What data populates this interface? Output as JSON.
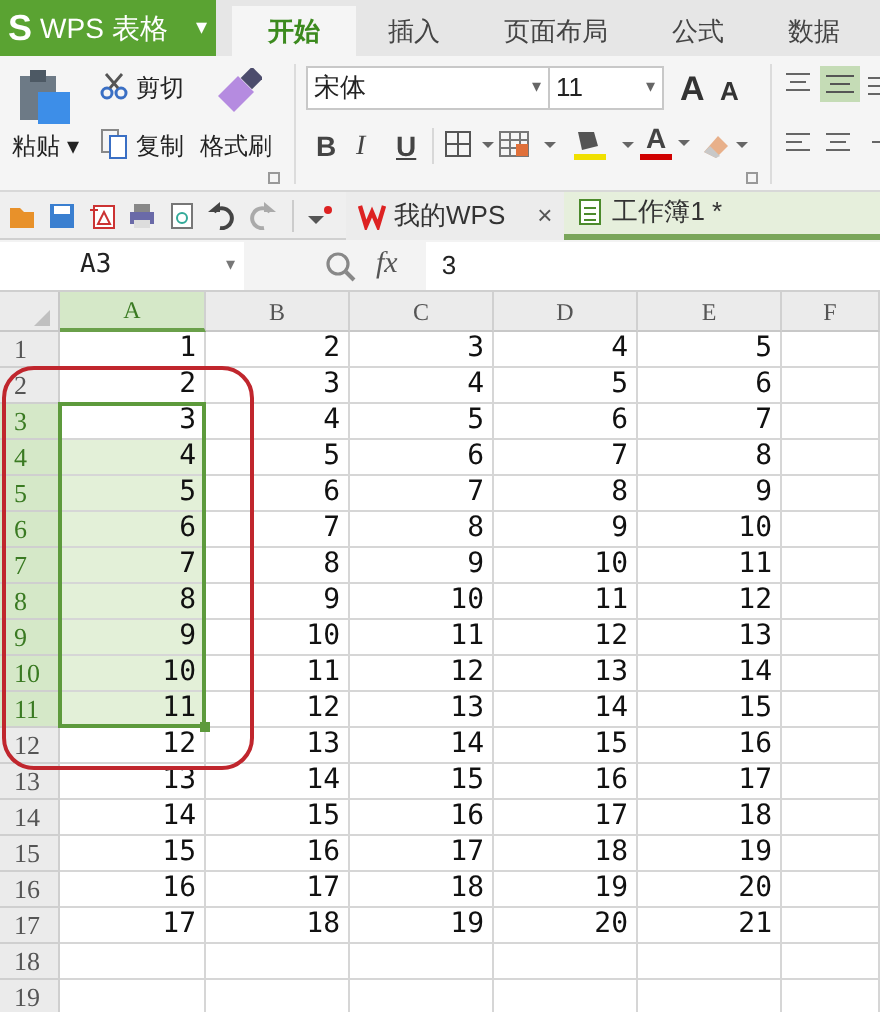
{
  "app": {
    "logo": "S",
    "title": "WPS 表格",
    "menu_caret": "▾"
  },
  "ribbon_tabs": [
    {
      "label": "开始",
      "selected": true
    },
    {
      "label": "插入",
      "selected": false
    },
    {
      "label": "页面布局",
      "selected": false
    },
    {
      "label": "公式",
      "selected": false
    },
    {
      "label": "数据",
      "selected": false
    }
  ],
  "clipboard": {
    "paste": "粘贴",
    "paste_caret": "▾",
    "cut": "剪切",
    "copy": "复制",
    "format_painter": "格式刷"
  },
  "font": {
    "name": "宋体",
    "size": "11",
    "caret": "▾"
  },
  "font_size_buttons": [
    {
      "label": "A",
      "kind": "grow"
    },
    {
      "label": "A",
      "kind": "shrink"
    }
  ],
  "style_buttons": [
    {
      "label": "B",
      "kind": "bold"
    },
    {
      "label": "I",
      "kind": "italic"
    },
    {
      "label": "U",
      "kind": "underline"
    }
  ],
  "font_color": {
    "label": "A",
    "color": "#d00000"
  },
  "fill_color": {
    "color": "#f0e000"
  },
  "document_tabs": [
    {
      "label": "我的WPS",
      "kind": "home",
      "close": "×",
      "selected": false
    },
    {
      "label": "工作簿1 *",
      "kind": "workbook",
      "selected": true
    }
  ],
  "formula_bar": {
    "name_box": "A3",
    "fx": "fx",
    "value": "3"
  },
  "columns": [
    {
      "label": "A",
      "selected": true
    },
    {
      "label": "B",
      "selected": false
    },
    {
      "label": "C",
      "selected": false
    },
    {
      "label": "D",
      "selected": false
    },
    {
      "label": "E",
      "selected": false
    },
    {
      "label": "F",
      "selected": false
    }
  ],
  "rows": [
    {
      "header": "1",
      "selected": false,
      "cells": [
        "1",
        "2",
        "3",
        "4",
        "5"
      ]
    },
    {
      "header": "2",
      "selected": false,
      "cells": [
        "2",
        "3",
        "4",
        "5",
        "6"
      ]
    },
    {
      "header": "3",
      "selected": true,
      "cells": [
        "3",
        "4",
        "5",
        "6",
        "7"
      ]
    },
    {
      "header": "4",
      "selected": true,
      "cells": [
        "4",
        "5",
        "6",
        "7",
        "8"
      ]
    },
    {
      "header": "5",
      "selected": true,
      "cells": [
        "5",
        "6",
        "7",
        "8",
        "9"
      ]
    },
    {
      "header": "6",
      "selected": true,
      "cells": [
        "6",
        "7",
        "8",
        "9",
        "10"
      ]
    },
    {
      "header": "7",
      "selected": true,
      "cells": [
        "7",
        "8",
        "9",
        "10",
        "11"
      ]
    },
    {
      "header": "8",
      "selected": true,
      "cells": [
        "8",
        "9",
        "10",
        "11",
        "12"
      ]
    },
    {
      "header": "9",
      "selected": true,
      "cells": [
        "9",
        "10",
        "11",
        "12",
        "13"
      ]
    },
    {
      "header": "10",
      "selected": true,
      "cells": [
        "10",
        "11",
        "12",
        "13",
        "14"
      ]
    },
    {
      "header": "11",
      "selected": true,
      "cells": [
        "11",
        "12",
        "13",
        "14",
        "15"
      ]
    },
    {
      "header": "12",
      "selected": false,
      "cells": [
        "12",
        "13",
        "14",
        "15",
        "16"
      ]
    },
    {
      "header": "13",
      "selected": false,
      "cells": [
        "13",
        "14",
        "15",
        "16",
        "17"
      ]
    },
    {
      "header": "14",
      "selected": false,
      "cells": [
        "14",
        "15",
        "16",
        "17",
        "18"
      ]
    },
    {
      "header": "15",
      "selected": false,
      "cells": [
        "15",
        "16",
        "17",
        "18",
        "19"
      ]
    },
    {
      "header": "16",
      "selected": false,
      "cells": [
        "16",
        "17",
        "18",
        "19",
        "20"
      ]
    },
    {
      "header": "17",
      "selected": false,
      "cells": [
        "17",
        "18",
        "19",
        "20",
        "21"
      ]
    },
    {
      "header": "18",
      "selected": false,
      "cells": []
    },
    {
      "header": "19",
      "selected": false,
      "cells": []
    }
  ],
  "annotation": {
    "kind": "rounded_outline",
    "color": "#c0262d"
  }
}
